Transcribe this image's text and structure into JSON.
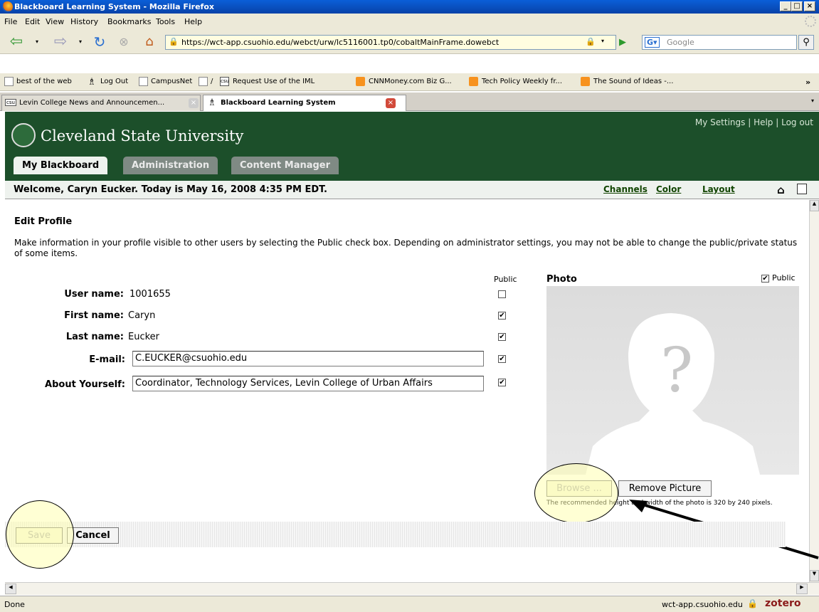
{
  "window": {
    "title": "Blackboard Learning System - Mozilla Firefox"
  },
  "menu": [
    "File",
    "Edit",
    "View",
    "History",
    "Bookmarks",
    "Tools",
    "Help"
  ],
  "nav": {
    "url": "https://wct-app.csuohio.edu/webct/urw/lc5116001.tp0/cobaltMainFrame.dowebct",
    "search_placeholder": "Google"
  },
  "bookmarks": [
    "best of the web",
    "Log Out",
    "CampusNet",
    "/",
    "Request Use of the IML",
    "CNNMoney.com Biz G...",
    "Tech Policy Weekly fr...",
    "The Sound of Ideas -..."
  ],
  "tabs": [
    {
      "label": "Levin College News and Announcemen..."
    },
    {
      "label": "Blackboard Learning System"
    }
  ],
  "header": {
    "university": "Cleveland State University",
    "links": [
      "My Settings",
      "Help",
      "Log out"
    ],
    "tabs": [
      "My Blackboard",
      "Administration",
      "Content Manager"
    ]
  },
  "welcome": {
    "text": "Welcome, Caryn Eucker. Today is May 16, 2008 4:35 PM EDT.",
    "links": [
      "Channels",
      "Color",
      "Layout"
    ]
  },
  "profile": {
    "heading": "Edit Profile",
    "description": "Make information in your profile visible to other users by selecting the Public check box. Depending on administrator settings, you may not be able to change the public/private status of some items.",
    "public_label": "Public",
    "fields": [
      {
        "label": "User name:",
        "value": "1001655",
        "public": false
      },
      {
        "label": "First name:",
        "value": "Caryn",
        "public": true
      },
      {
        "label": "Last name:",
        "value": "Eucker",
        "public": true
      },
      {
        "label": "E-mail:",
        "value": "C.EUCKER@csuohio.edu",
        "public": true
      },
      {
        "label": "About Yourself:",
        "value": "Coordinator, Technology Services, Levin College of Urban Affairs",
        "public": true
      }
    ],
    "photo": {
      "label": "Photo",
      "public_label": "Public",
      "browse": "Browse ...",
      "remove": "Remove Picture",
      "note": "The recommended height and width of the photo is 320 by 240 pixels."
    },
    "save": "Save",
    "cancel": "Cancel"
  },
  "status": {
    "text": "Done",
    "host": "wct-app.csuohio.edu",
    "zotero": "zotero"
  },
  "colors": {
    "brand_green": "#1c4f2a",
    "title_blue": "#0a5fd8"
  }
}
